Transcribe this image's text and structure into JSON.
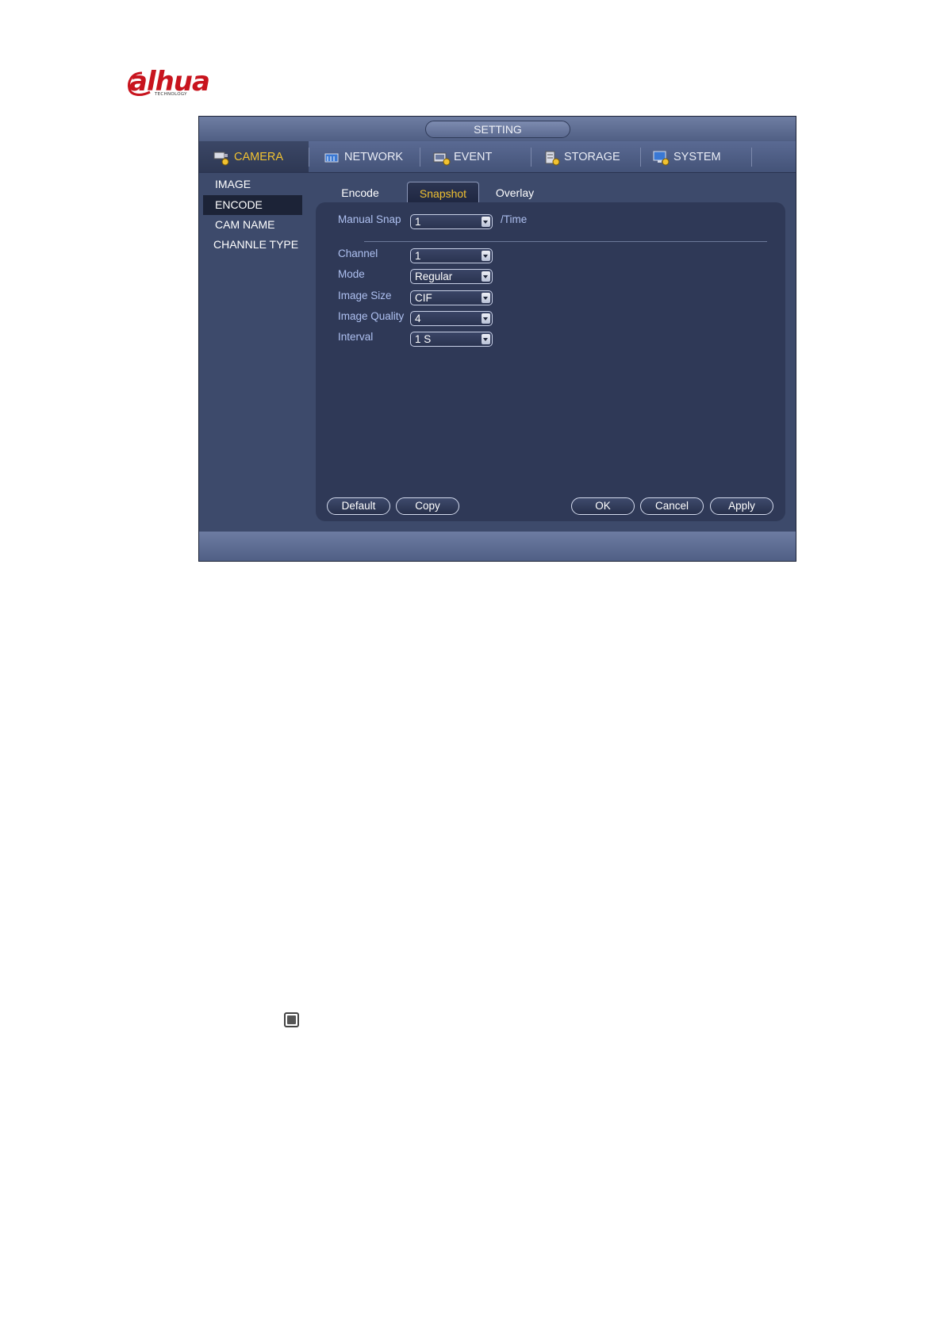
{
  "logo": {
    "brand": "alhua",
    "tagline": "TECHNOLOGY"
  },
  "window": {
    "title": "SETTING"
  },
  "topnav": [
    {
      "label": "CAMERA",
      "icon": "camera-settings-icon"
    },
    {
      "label": "NETWORK",
      "icon": "network-icon"
    },
    {
      "label": "EVENT",
      "icon": "event-icon"
    },
    {
      "label": "STORAGE",
      "icon": "storage-icon"
    },
    {
      "label": "SYSTEM",
      "icon": "system-icon"
    }
  ],
  "sidebar": {
    "items": [
      "IMAGE",
      "ENCODE",
      "CAM NAME",
      "CHANNLE TYPE"
    ],
    "selected": "ENCODE"
  },
  "subtabs": {
    "items": [
      "Encode",
      "Snapshot",
      "Overlay"
    ],
    "selected": "Snapshot"
  },
  "form": {
    "manual_snap": {
      "label": "Manual Snap",
      "value": "1",
      "suffix": "/Time"
    },
    "channel": {
      "label": "Channel",
      "value": "1"
    },
    "mode": {
      "label": "Mode",
      "value": "Regular"
    },
    "image_size": {
      "label": "Image Size",
      "value": "CIF"
    },
    "image_quality": {
      "label": "Image Quality",
      "value": "4"
    },
    "interval": {
      "label": "Interval",
      "value": "1 S"
    }
  },
  "buttons": {
    "default": "Default",
    "copy": "Copy",
    "ok": "OK",
    "cancel": "Cancel",
    "apply": "Apply"
  },
  "colors": {
    "active_highlight": "#f1c231",
    "label_blue": "#aec0f0",
    "panel_bg": "#2f3957",
    "brand_red": "#c8141e"
  }
}
